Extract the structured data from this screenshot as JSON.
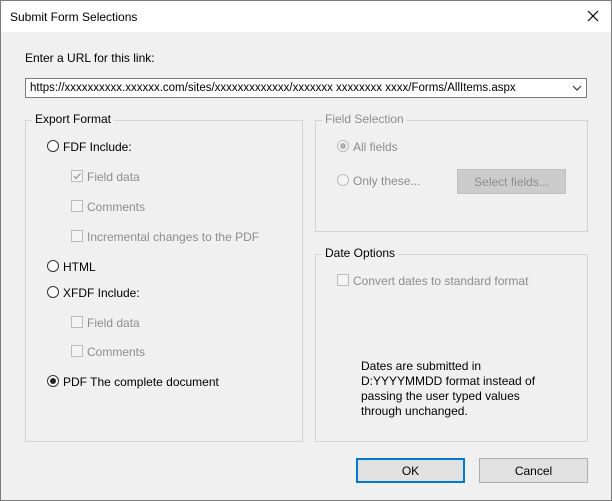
{
  "window": {
    "title": "Submit Form Selections"
  },
  "url": {
    "label": "Enter a URL for this link:",
    "value": "https://xxxxxxxxxx.xxxxxx.com/sites/xxxxxxxxxxxxx/xxxxxxx xxxxxxxx xxxx/Forms/AllItems.aspx"
  },
  "export_format": {
    "title": "Export Format",
    "fdf": {
      "label": "FDF  Include:",
      "selected": false,
      "options": {
        "field_data": "Field data",
        "comments": "Comments",
        "incremental": "Incremental changes to the PDF"
      }
    },
    "html": {
      "label": "HTML",
      "selected": false
    },
    "xfdf": {
      "label": "XFDF  Include:",
      "selected": false,
      "options": {
        "field_data": "Field data",
        "comments": "Comments"
      }
    },
    "pdf": {
      "label": "PDF  The complete document",
      "selected": true
    }
  },
  "field_selection": {
    "title": "Field Selection",
    "all_fields": "All fields",
    "only_these": "Only these...",
    "select_button": "Select fields..."
  },
  "date_options": {
    "title": "Date Options",
    "convert_label": "Convert dates to standard format",
    "info": "Dates are submitted in D:YYYYMMDD format instead of passing the user typed values through unchanged."
  },
  "buttons": {
    "ok": "OK",
    "cancel": "Cancel"
  },
  "colors": {
    "accent": "#0078d7",
    "disabled_text": "#8d8d8d",
    "dialog_bg": "#f0f0f0"
  }
}
